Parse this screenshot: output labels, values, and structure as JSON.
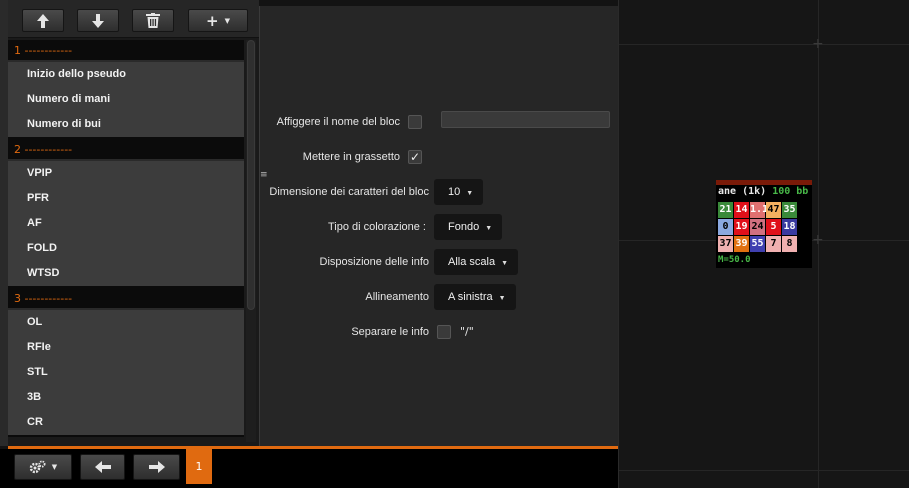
{
  "toolbar": {
    "buttons": [
      {
        "icon": "arrow-up-icon"
      },
      {
        "icon": "arrow-down-icon"
      },
      {
        "icon": "trash-icon"
      },
      {
        "icon": "plus-icon",
        "label": "+",
        "caret": "▼"
      }
    ]
  },
  "sections": [
    {
      "header": "1 ------------",
      "items": [
        "Inizio dello pseudo",
        "Numero di mani",
        "Numero di bui"
      ]
    },
    {
      "header": "2 ------------",
      "items": [
        "VPIP",
        "PFR",
        "AF",
        "FOLD",
        "WTSD"
      ]
    },
    {
      "header": "3 ------------",
      "items": [
        "OL",
        "RFIe",
        "STL",
        "3B",
        "CR"
      ]
    }
  ],
  "settings": {
    "splitter_glyph": "≡",
    "show_name_label": "Affiggere il nome del bloc",
    "bold_label": "Mettere in grassetto",
    "bold_checked": "✓",
    "font_size_label": "Dimensione dei caratteri del bloc",
    "font_size_value": "10",
    "color_type_label": "Tipo di colorazione :",
    "color_type_value": "Fondo",
    "layout_label": "Disposizione delle info",
    "layout_value": "Alla scala",
    "align_label": "Allineamento",
    "align_value": "A sinistra",
    "separate_label": "Separare le info",
    "separate_value": "\"/\"",
    "caret": "▼"
  },
  "hud": {
    "name": "ane (1k)",
    "bb": "100 bb",
    "rows": [
      [
        {
          "v": "21",
          "bg": "#3a8a3a",
          "fg": "#ffffff"
        },
        {
          "v": "14",
          "bg": "#e0101a",
          "fg": "#ffffff"
        },
        {
          "v": "1.1",
          "bg": "#e07070",
          "fg": "#ffffff"
        },
        {
          "v": "47",
          "bg": "#f5b060",
          "fg": "#000000"
        },
        {
          "v": "35",
          "bg": "#3a8a3a",
          "fg": "#ffffff"
        }
      ],
      [
        {
          "v": "0",
          "bg": "#8aa8e0",
          "fg": "#000000"
        },
        {
          "v": "19",
          "bg": "#e0101a",
          "fg": "#ffffff"
        },
        {
          "v": "24",
          "bg": "#d07080",
          "fg": "#000000"
        },
        {
          "v": "5",
          "bg": "#e0101a",
          "fg": "#ffffff"
        },
        {
          "v": "18",
          "bg": "#3a3aa0",
          "fg": "#ffffff"
        }
      ],
      [
        {
          "v": "37",
          "bg": "#f0b0b0",
          "fg": "#000000"
        },
        {
          "v": "39",
          "bg": "#e07010",
          "fg": "#ffffff"
        },
        {
          "v": "55",
          "bg": "#4040b0",
          "fg": "#ffffff"
        },
        {
          "v": "7",
          "bg": "#f0b0b0",
          "fg": "#000000"
        },
        {
          "v": "8",
          "bg": "#f0b0b0",
          "fg": "#000000"
        }
      ]
    ],
    "m_value": "M=50.0"
  },
  "bottom": {
    "settings_caret": "▼",
    "prev_icon": "arrow-left-icon",
    "next_icon": "arrow-right-icon",
    "page": "1"
  }
}
